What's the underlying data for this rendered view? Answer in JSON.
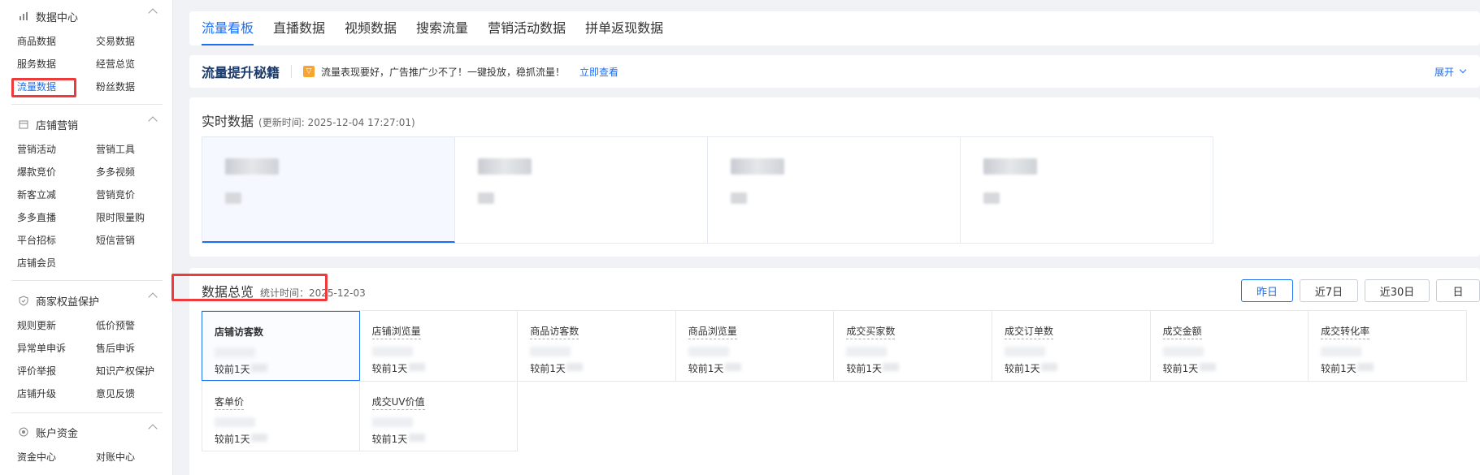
{
  "sidebar": {
    "sections": [
      {
        "title": "数据中心",
        "icon": "bar-chart-icon",
        "items": [
          "商品数据",
          "交易数据",
          "服务数据",
          "经营总览",
          "流量数据",
          "粉丝数据"
        ]
      },
      {
        "title": "店铺营销",
        "icon": "calendar-icon",
        "items": [
          "营销活动",
          "营销工具",
          "爆款竞价",
          "多多视频",
          "新客立减",
          "营销竞价",
          "多多直播",
          "限时限量购",
          "平台招标",
          "短信营销",
          "店铺会员"
        ]
      },
      {
        "title": "商家权益保护",
        "icon": "shield-icon",
        "items": [
          "规则更新",
          "低价预警",
          "异常单申诉",
          "售后申诉",
          "评价举报",
          "知识产权保护",
          "店铺升级",
          "意见反馈"
        ]
      },
      {
        "title": "账户资金",
        "icon": "coin-icon",
        "items": [
          "资金中心",
          "对账中心"
        ]
      }
    ],
    "active_item": "流量数据"
  },
  "tabs": [
    "流量看板",
    "直播数据",
    "视频数据",
    "搜索流量",
    "营销活动数据",
    "拼单返现数据"
  ],
  "active_tab": "流量看板",
  "banner": {
    "title": "流量提升秘籍",
    "text": "流量表现要好，广告推广少不了！一键投放，稳抓流量！",
    "link": "立即查看",
    "expand": "展开"
  },
  "realtime": {
    "title": "实时数据",
    "updated": "(更新时间: 2025-12-04 17:27:01)"
  },
  "overview": {
    "title": "数据总览",
    "stat_time": "统计时间：2025-12-03",
    "buttons": [
      "昨日",
      "近7日",
      "近30日",
      "日"
    ],
    "active_button": "昨日",
    "compare_label": "较前1天",
    "metrics_row1": [
      "店铺访客数",
      "店铺浏览量",
      "商品访客数",
      "商品浏览量",
      "成交买家数",
      "成交订单数",
      "成交金额",
      "成交转化率"
    ],
    "metrics_row2": [
      "客单价",
      "成交UV价值"
    ]
  },
  "colors": {
    "accent": "#1c6ef2",
    "highlight_box": "#ee3a3a"
  }
}
